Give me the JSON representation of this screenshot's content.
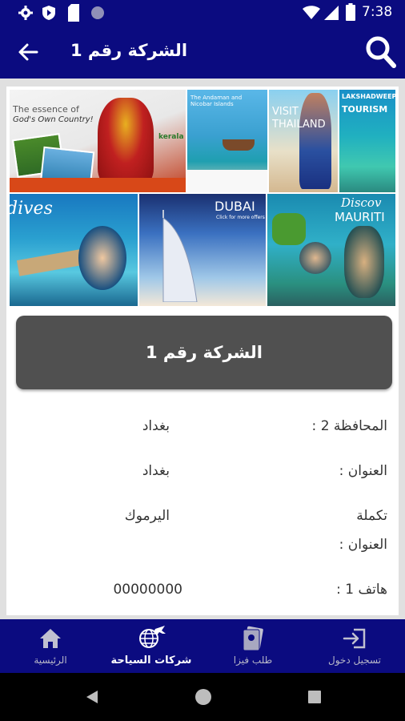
{
  "status_bar": {
    "time": "7:38"
  },
  "app_bar": {
    "title": "الشركة رقم 1"
  },
  "banner": {
    "tile_texts": {
      "kerala_line1": "The essence of",
      "kerala_line2": "God's Own Country!",
      "kerala_logo": "kerala",
      "andaman": "The Andaman and Nicobar Islands",
      "thailand_line1": "VISIT",
      "thailand_line2": "THAILAND",
      "lakshadweep_line1": "LAKSHADWEEP",
      "lakshadweep_line2": "TOURISM",
      "maldives": "dives",
      "dubai": "DUBAI",
      "dubai_sub": "Click for more offers",
      "mauritius_line1": "Discov",
      "mauritius_line2": "MAURITI"
    }
  },
  "company": {
    "name": "الشركة رقم 1",
    "details": [
      {
        "label": "المحافظة 2 :",
        "value": "بغداد"
      },
      {
        "label": "العنوان :",
        "value": "بغداد"
      },
      {
        "label_line1": "تكملة",
        "label_line2": "العنوان :",
        "value": "اليرموك"
      },
      {
        "label": "هاتف 1 :",
        "value": "00000000"
      }
    ]
  },
  "bottom_nav": {
    "items": [
      {
        "label": "الرئيسية",
        "icon": "home-icon"
      },
      {
        "label": "شركات السياحة",
        "icon": "globe-plane-icon"
      },
      {
        "label": "طلب فيزا",
        "icon": "visa-card-icon"
      },
      {
        "label": "تسجيل دخول",
        "icon": "login-icon"
      }
    ],
    "active_index": 1
  },
  "colors": {
    "primary": "#0b0b80",
    "name_box": "#505050",
    "background": "#e0e0e0"
  }
}
